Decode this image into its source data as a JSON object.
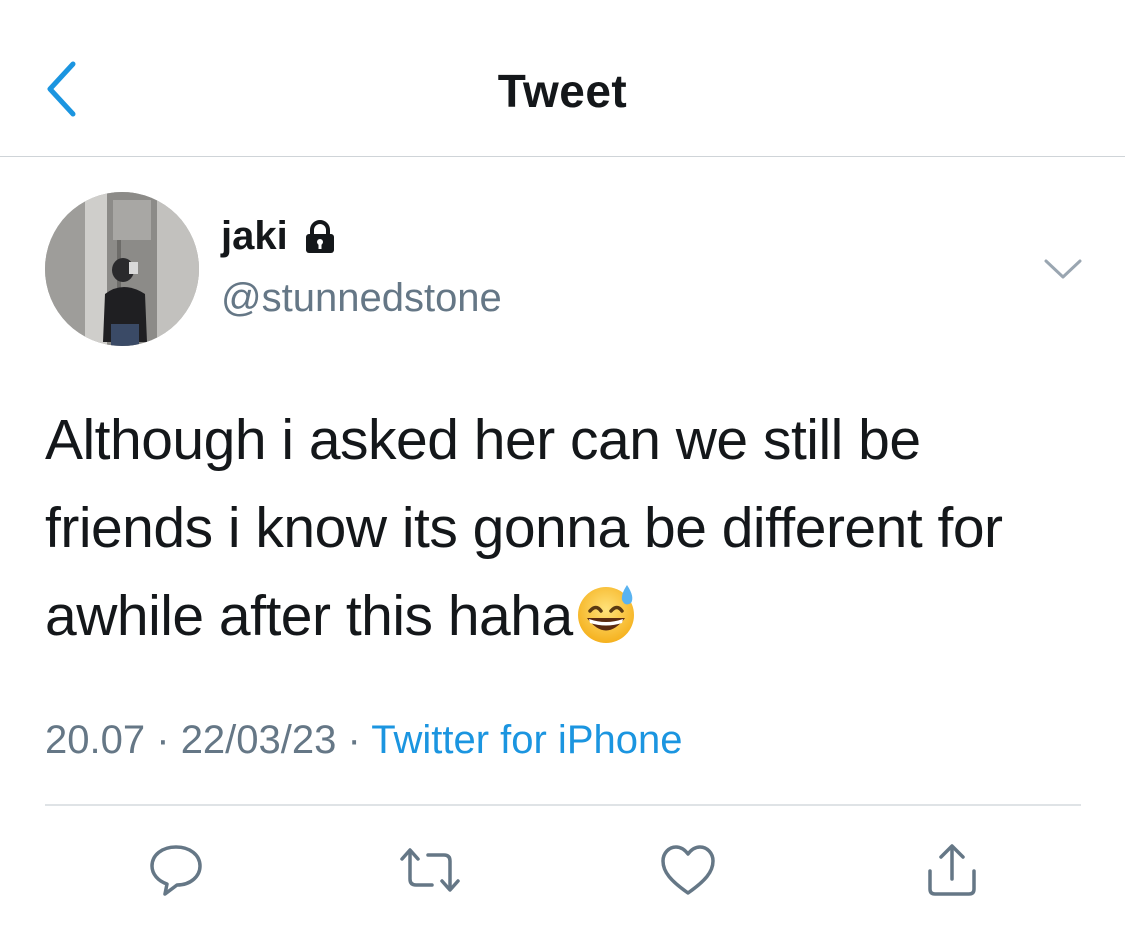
{
  "header": {
    "title": "Tweet",
    "back_icon": "chevron-left-icon"
  },
  "tweet": {
    "author": {
      "display_name": "jaki",
      "handle": "@stunnedstone",
      "protected_icon": "lock-icon",
      "avatar": "mirror-selfie-avatar"
    },
    "text": "Although i asked her can we still be friends i know its gonna be different for awhile after this haha",
    "emoji": "grinning-face-with-sweat",
    "time": "20.07",
    "separator": "·",
    "date": "22/03/23",
    "source": "Twitter for iPhone",
    "more_icon": "chevron-down-icon"
  },
  "actions": [
    {
      "name": "reply",
      "icon": "speech-bubble-icon"
    },
    {
      "name": "retweet",
      "icon": "retweet-icon"
    },
    {
      "name": "like",
      "icon": "heart-icon"
    },
    {
      "name": "share",
      "icon": "share-icon"
    }
  ],
  "colors": {
    "accent": "#1b95e0",
    "secondary_text": "#657786",
    "primary_text": "#14171a",
    "icon_gray": "#657786"
  }
}
